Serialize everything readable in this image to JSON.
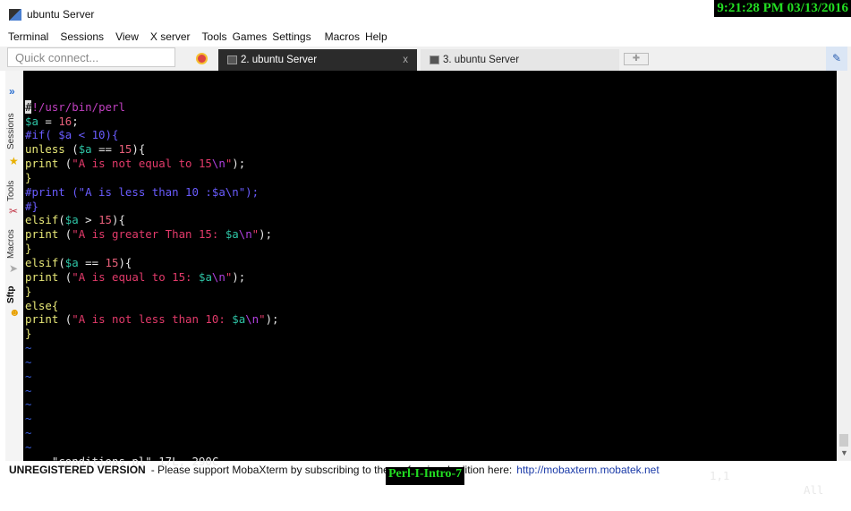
{
  "window": {
    "title": "ubuntu Server",
    "clock": "9:21:28 PM 03/13/2016"
  },
  "menu": [
    "Terminal",
    "Sessions",
    "View",
    "X server",
    "Tools",
    "Games",
    "Settings",
    "Macros",
    "Help"
  ],
  "quick_connect": {
    "placeholder": "Quick connect..."
  },
  "tabs": [
    {
      "label": "2. ubuntu Server",
      "active": true,
      "close": "x"
    },
    {
      "label": "3. ubuntu Server",
      "active": false
    }
  ],
  "sidebar": {
    "labels": [
      "Sessions",
      "Tools",
      "Macros",
      "Sftp"
    ]
  },
  "colors": {
    "keyword": "#e8e878",
    "string": "#e23a6a",
    "variable": "#2ec4a6",
    "number": "#e8607a",
    "comment": "#6a5cff"
  },
  "code": [
    [
      [
        "#",
        "cursor"
      ],
      [
        "!/usr/bin/perl",
        "she"
      ]
    ],
    [
      [
        "$a",
        "var"
      ],
      [
        " = ",
        "pl"
      ],
      [
        "16",
        "num"
      ],
      [
        ";",
        "pl"
      ]
    ],
    [
      [
        "#if( $a < 10){",
        "cmt"
      ]
    ],
    [
      [
        "unless",
        "kw"
      ],
      [
        " (",
        "pl"
      ],
      [
        "$a",
        "var"
      ],
      [
        " == ",
        "pl"
      ],
      [
        "15",
        "num"
      ],
      [
        "){",
        "pl"
      ]
    ],
    [
      [
        "print",
        "kw"
      ],
      [
        " (",
        "pl"
      ],
      [
        "\"A is not equal to 15",
        "str"
      ],
      [
        "\\n",
        "esc"
      ],
      [
        "\"",
        "str"
      ],
      [
        ");",
        "pl"
      ]
    ],
    [
      [
        "}",
        "kw"
      ]
    ],
    [
      [
        "#print (\"A is less than 10 :$a\\n\");",
        "cmt"
      ]
    ],
    [
      [
        "#}",
        "cmt"
      ]
    ],
    [
      [
        "elsif",
        "kw"
      ],
      [
        "(",
        "pl"
      ],
      [
        "$a",
        "var"
      ],
      [
        " > ",
        "pl"
      ],
      [
        "15",
        "num"
      ],
      [
        "){",
        "pl"
      ]
    ],
    [
      [
        "print",
        "kw"
      ],
      [
        " (",
        "pl"
      ],
      [
        "\"A is greater Than 15: ",
        "str"
      ],
      [
        "$a",
        "var"
      ],
      [
        "\\n",
        "esc"
      ],
      [
        "\"",
        "str"
      ],
      [
        ");",
        "pl"
      ]
    ],
    [
      [
        "}",
        "kw"
      ]
    ],
    [
      [
        "elsif",
        "kw"
      ],
      [
        "(",
        "pl"
      ],
      [
        "$a",
        "var"
      ],
      [
        " == ",
        "pl"
      ],
      [
        "15",
        "num"
      ],
      [
        "){",
        "pl"
      ]
    ],
    [
      [
        "print",
        "kw"
      ],
      [
        " (",
        "pl"
      ],
      [
        "\"A is equal to 15: ",
        "str"
      ],
      [
        "$a",
        "var"
      ],
      [
        "\\n",
        "esc"
      ],
      [
        "\"",
        "str"
      ],
      [
        ");",
        "pl"
      ]
    ],
    [
      [
        "}",
        "kw"
      ]
    ],
    [
      [
        "else{",
        "kw"
      ]
    ],
    [
      [
        "print",
        "kw"
      ],
      [
        " (",
        "pl"
      ],
      [
        "\"A is not less than 10: ",
        "str"
      ],
      [
        "$a",
        "var"
      ],
      [
        "\\n",
        "esc"
      ],
      [
        "\"",
        "str"
      ],
      [
        ");",
        "pl"
      ]
    ],
    [
      [
        "}",
        "kw"
      ]
    ]
  ],
  "tilde": "~",
  "tilde_count": 8,
  "status": {
    "file": "\"conditions.pl\" 17L, 290C",
    "position": "1,1",
    "scroll": "All"
  },
  "footer": {
    "label": "UNREGISTERED VERSION",
    "message": "-  Please support MobaXterm by subscribing to the professional edition here:",
    "link": "http://mobaxterm.mobatek.net"
  },
  "watermark": "Perl-I-Intro-7"
}
